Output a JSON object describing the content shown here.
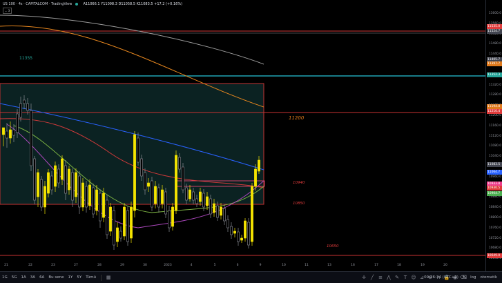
{
  "legend": {
    "symbol": "US 100 · 4s · CAPITALCOM · TradingView",
    "ohlc": "A11066.1  Y11098.3  D11058.5  K11083.5  +17.2 (+0.16%)",
    "collapse_label": "⌄ 3"
  },
  "chart_annotations": {
    "level_11355": "11355",
    "level_11200": "11200",
    "level_10940": "10940",
    "level_10850": "10850",
    "level_10650": "10650"
  },
  "price_axis": {
    "ticks": [
      "11600.0",
      "11560.0",
      "11520.0",
      "11480.0",
      "11440.0",
      "11400.0",
      "11360.0",
      "11320.0",
      "11280.0",
      "11240.0",
      "11200.0",
      "11160.0",
      "11120.0",
      "11080.0",
      "11040.0",
      "11000.0",
      "10960.0",
      "10920.0",
      "10880.0",
      "10840.0",
      "10800.0",
      "10760.0",
      "10720.0",
      "10680.0",
      "10640.0"
    ],
    "tags": [
      {
        "text": "11535.0",
        "color": "#e03c3c"
      },
      {
        "text": "11524.7",
        "color": "#434651"
      },
      {
        "text": "11405.7",
        "color": "#434651"
      },
      {
        "text": "11397.7",
        "color": "#e07a1c"
      },
      {
        "text": "11352.3",
        "color": "#26a69a"
      },
      {
        "text": "11210.4",
        "color": "#e03c3c"
      },
      {
        "text": "11194.8",
        "color": "#e07a1c"
      },
      {
        "text": "11083.5",
        "color": "#434651"
      },
      {
        "text": "11064.7",
        "color": "#2962ff"
      },
      {
        "text": "10933.8",
        "color": "#ef3c8c"
      },
      {
        "text": "10930.5",
        "color": "#e03c3c"
      },
      {
        "text": "10904.7",
        "color": "#4caf50"
      },
      {
        "text": "10649.0",
        "color": "#e03c3c"
      }
    ]
  },
  "time_axis": [
    "21",
    "22",
    "23",
    "27",
    "28",
    "29",
    "30",
    "2023",
    "4",
    "5",
    "6",
    "9",
    "10",
    "11",
    "13",
    "16",
    "17",
    "18",
    "19",
    "20"
  ],
  "bottom_bar": {
    "ranges": [
      "1G",
      "5G",
      "1A",
      "3A",
      "6A",
      "Bu sene",
      "1Y",
      "5Y",
      "Tümü"
    ],
    "time": "09:26:34 (UTC+3)",
    "scale_pct": "%",
    "scale_log": "log",
    "scale_auto": "otomatik"
  }
}
